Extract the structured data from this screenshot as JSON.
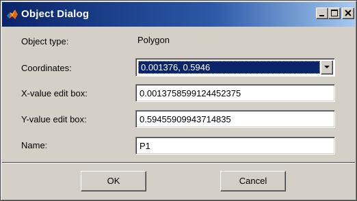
{
  "window": {
    "title": "Object Dialog",
    "accent_color": "#0a246a",
    "icon": "matlab-logo-icon"
  },
  "controls": {
    "minimize_icon": "minimize-icon",
    "maximize_icon": "maximize-icon",
    "close_icon": "close-icon"
  },
  "fields": {
    "object_type": {
      "label": "Object type:",
      "value": "Polygon"
    },
    "coordinates": {
      "label": "Coordinates:",
      "selected": "0.001376, 0.5946"
    },
    "x_value": {
      "label": "X-value edit box:",
      "value": "0.0013758599124452375"
    },
    "y_value": {
      "label": "Y-value edit box:",
      "value": "0.59455909943714835"
    },
    "name": {
      "label": "Name:",
      "value": "P1"
    }
  },
  "buttons": {
    "ok": "OK",
    "cancel": "Cancel"
  }
}
